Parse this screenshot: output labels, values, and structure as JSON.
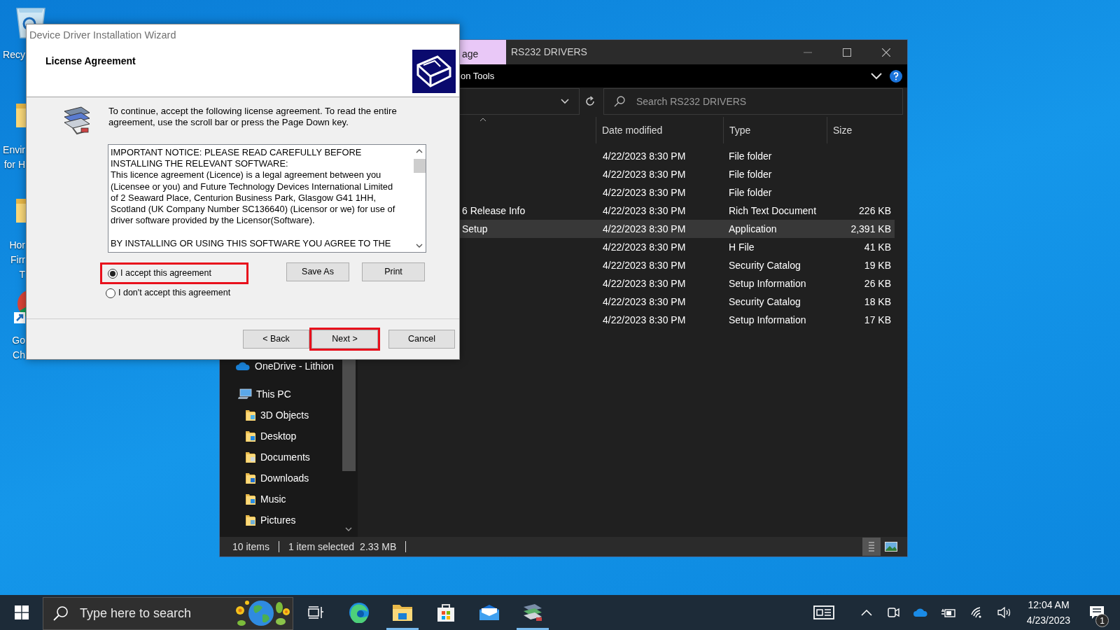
{
  "desktop_icons": [
    {
      "kind": "recycle_bin",
      "label": "Recy"
    },
    {
      "kind": "folder",
      "label": "Envir\nfor H"
    },
    {
      "kind": "folder",
      "label": "Hor\nFirr\nT"
    },
    {
      "kind": "chrome_shortcut",
      "label": "Go\nCh"
    }
  ],
  "explorer": {
    "context_tab": "age",
    "title": "RS232 DRIVERS",
    "ribbon_tab": "on Tools",
    "search": {
      "placeholder": "Search RS232 DRIVERS"
    },
    "columns": [
      "Date modified",
      "Type",
      "Size"
    ],
    "rows": [
      {
        "date": "4/22/2023 8:30 PM",
        "type": "File folder",
        "selected": false
      },
      {
        "date": "4/22/2023 8:30 PM",
        "type": "File folder",
        "selected": false
      },
      {
        "date": "4/22/2023 8:30 PM",
        "type": "File folder",
        "selected": false
      },
      {
        "name": "6 Release Info",
        "date": "4/22/2023 8:30 PM",
        "type": "Rich Text Document",
        "size": "226 KB",
        "selected": false
      },
      {
        "name": "Setup",
        "date": "4/22/2023 8:30 PM",
        "type": "Application",
        "size": "2,391 KB",
        "selected": true
      },
      {
        "date": "4/22/2023 8:30 PM",
        "type": "H File",
        "size": "41 KB",
        "selected": false
      },
      {
        "date": "4/22/2023 8:30 PM",
        "type": "Security Catalog",
        "size": "19 KB",
        "selected": false
      },
      {
        "date": "4/22/2023 8:30 PM",
        "type": "Setup Information",
        "size": "26 KB",
        "selected": false
      },
      {
        "date": "4/22/2023 8:30 PM",
        "type": "Security Catalog",
        "size": "18 KB",
        "selected": false
      },
      {
        "date": "4/22/2023 8:30 PM",
        "type": "Setup Information",
        "size": "17 KB",
        "selected": false
      }
    ],
    "nav": [
      {
        "label": "OneDrive - Lithion",
        "kind": "onedrive"
      },
      {
        "label": "This PC",
        "kind": "pc",
        "children": [
          {
            "label": "3D Objects",
            "kind": "objects"
          },
          {
            "label": "Desktop",
            "kind": "desktop"
          },
          {
            "label": "Documents",
            "kind": "documents"
          },
          {
            "label": "Downloads",
            "kind": "downloads"
          },
          {
            "label": "Music",
            "kind": "music"
          },
          {
            "label": "Pictures",
            "kind": "pictures"
          }
        ]
      }
    ],
    "status": {
      "count": "10 items",
      "selection": "1 item selected",
      "size": "2.33 MB"
    }
  },
  "wizard": {
    "title": "Device Driver Installation Wizard",
    "heading": "License Agreement",
    "instruction": "To continue, accept the following license agreement. To read the entire\nagreement, use the scroll bar or press the Page Down key.",
    "license_text": "IMPORTANT NOTICE: PLEASE READ CAREFULLY BEFORE\nINSTALLING THE RELEVANT SOFTWARE:\nThis licence agreement (Licence) is a legal agreement between you\n(Licensee or you) and Future Technology Devices International Limited\nof 2 Seaward Place, Centurion Business Park, Glasgow G41 1HH,\nScotland (UK Company Number SC136640) (Licensor or we) for use of\ndriver software provided by the Licensor(Software).\n\nBY INSTALLING OR USING THIS SOFTWARE YOU AGREE TO THE",
    "options": [
      {
        "label": "I accept this agreement",
        "selected": true,
        "highlighted": true
      },
      {
        "label": "I don't accept this agreement",
        "selected": false,
        "highlighted": false
      }
    ],
    "side_buttons": [
      "Save As",
      "Print"
    ],
    "buttons": [
      {
        "label": "< Back",
        "highlighted": false
      },
      {
        "label": "Next >",
        "highlighted": true
      },
      {
        "label": "Cancel",
        "highlighted": false
      }
    ]
  },
  "taskbar": {
    "search": {
      "placeholder": "Type here to search"
    },
    "apps": [
      {
        "kind": "task_view",
        "active": false
      },
      {
        "kind": "edge",
        "active": false
      },
      {
        "kind": "explorer",
        "active": true
      },
      {
        "kind": "store",
        "active": false
      },
      {
        "kind": "mail",
        "active": false
      },
      {
        "kind": "installer",
        "active": true
      }
    ],
    "time": "12:04 AM",
    "date": "4/23/2023",
    "notifications": "1"
  }
}
